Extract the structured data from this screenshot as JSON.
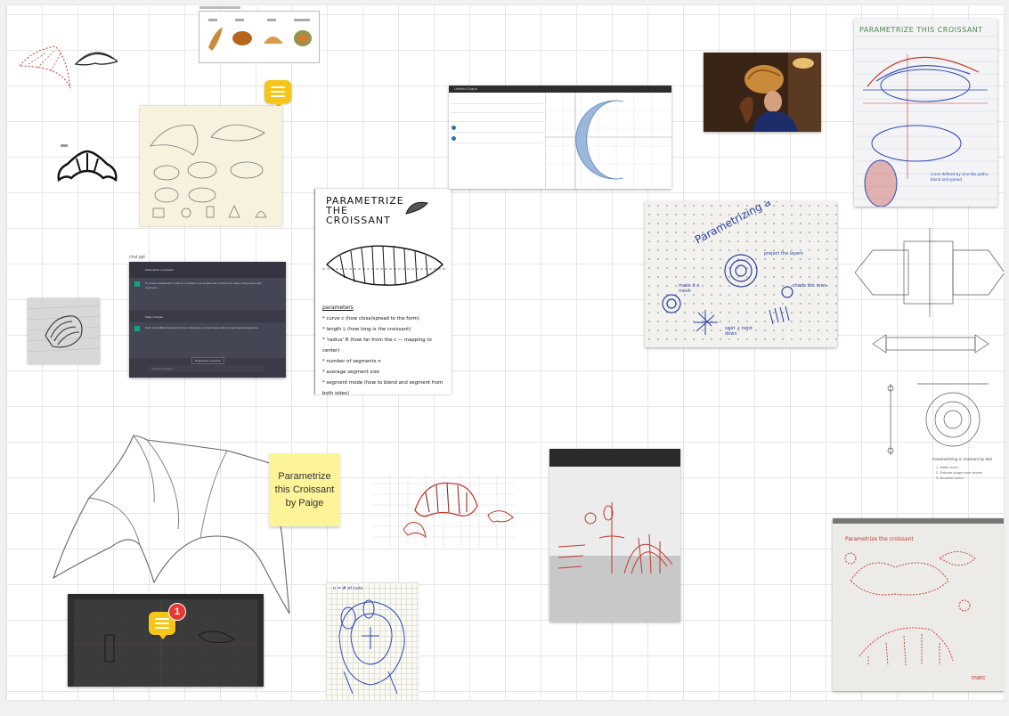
{
  "board": {
    "background": "#ffffff",
    "canvas_bg": "#f1f1f1"
  },
  "sticky_note": {
    "text": "Parametrize this Croissant by Paige",
    "color": "#fdf49a"
  },
  "comments": [
    {
      "id": "comment-1",
      "icon": "comment-icon"
    },
    {
      "id": "comment-2",
      "icon": "comment-icon",
      "badge": "1"
    }
  ],
  "sketch_notebook": {
    "title": "PARAMETRIZE THE CROISSANT",
    "params_heading": "parameters",
    "params": [
      "* curve c (how close/spread to the form)",
      "* length L (how long is the croissant)",
      "* 'radius' R (how far from the c — mapping to center)",
      "* number of segments n",
      "* average segment size",
      "* segment mode (how to blend and segment from both sides)"
    ]
  },
  "dot_grid_paper": {
    "title": "Parametrizing a croissant",
    "notes": [
      "make it a mesh",
      "project the layers",
      "shade the rows",
      "swirl + twist down"
    ]
  },
  "lined_sketch": {
    "title": "PARAMETRIZE THIS CROISSANT",
    "caption": "curve defined by sine-like paths, blend and spread"
  },
  "wei_panel": {
    "caption": "Parametrizing a croissant by Wei",
    "steps": [
      "1. Make circle",
      "2. Extrude shape from circles",
      "3. Boolean Union"
    ]
  },
  "red_sketch_pad": {
    "title": "Parametrize the croissant",
    "signature": "marc"
  },
  "blue_sketch": {
    "label": "n = # of cuts"
  },
  "chatgpt": {
    "tag": "chat gpt",
    "messages": [
      "Parametrize a croissant",
      "To create a parametric model of a croissant, you would need to define the shape using curves and segments...",
      "Make it simpler",
      "Sure! A simplified croissant can be modeled as a curved body made of a few tapered segments..."
    ],
    "regenerate": "Regenerate response",
    "input_placeholder": "Send a message..."
  },
  "desmos": {
    "tab": "Untitled Graph"
  },
  "colors": {
    "sketch_red": "#c0392b",
    "sketch_blue": "#2a49b8",
    "moon_fill": "#9bb7dc",
    "sticky_yellow": "#fdf49a",
    "comment_yellow": "#f5c518",
    "badge_red": "#e53935"
  }
}
